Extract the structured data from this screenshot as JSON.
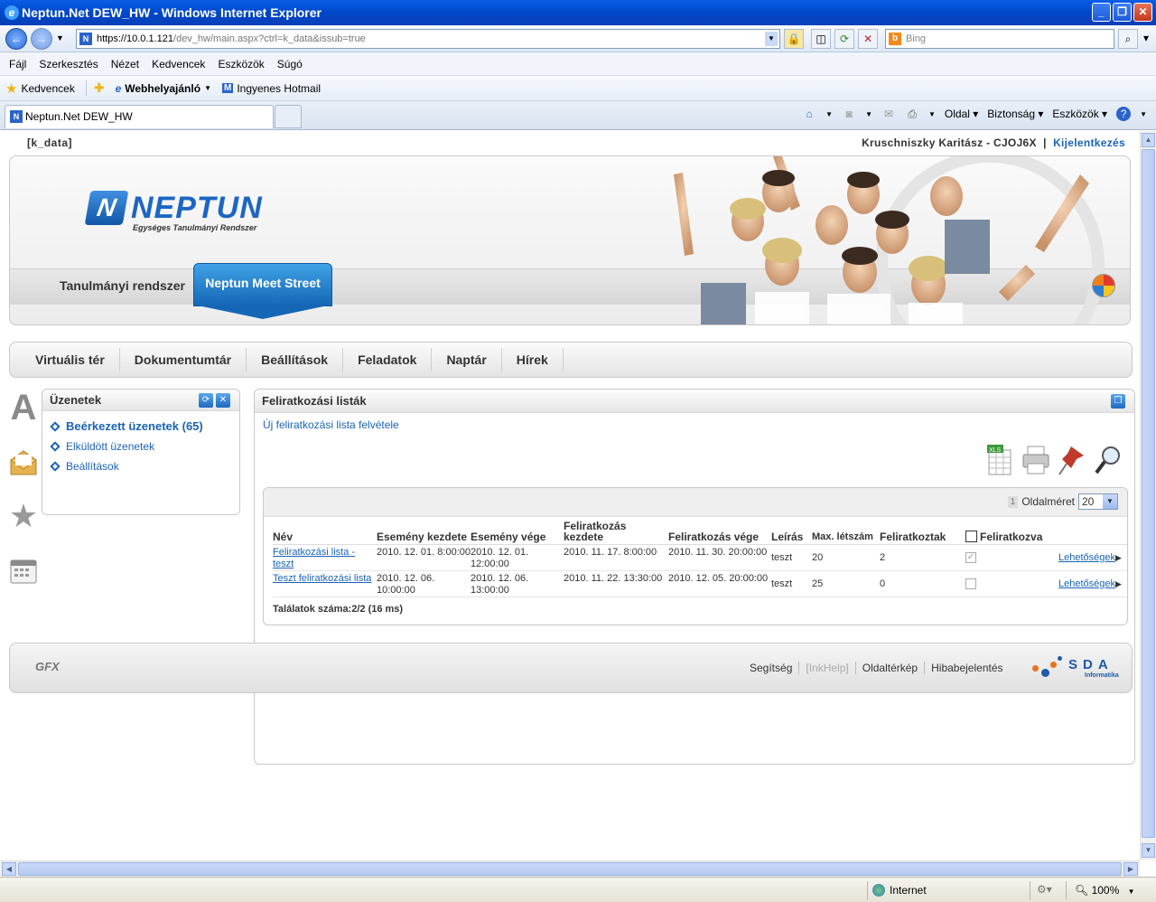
{
  "browser": {
    "window_title": "Neptun.Net DEW_HW - Windows Internet Explorer",
    "address_host": "https://10.0.1.121",
    "address_path": "/dev_hw/main.aspx?ctrl=k_data&issub=true",
    "search_placeholder": "Bing",
    "menu": [
      "Fájl",
      "Szerkesztés",
      "Nézet",
      "Kedvencek",
      "Eszközök",
      "Súgó"
    ],
    "favorites": {
      "label": "Kedvencek",
      "items": [
        "Webhelyajánló",
        "Ingyenes Hotmail"
      ]
    },
    "tab_title": "Neptun.Net DEW_HW",
    "command_bar": [
      "Oldal",
      "Biztonság",
      "Eszközök"
    ],
    "status": {
      "zone": "Internet",
      "zoom": "100%"
    }
  },
  "page": {
    "ctrl": "[k_data]",
    "user": "Kruschniszky Karitász - CJOJ6X",
    "separator": "|",
    "logout": "Kijelentkezés",
    "logo_text": "NEPTUN",
    "logo_sub": "Egységes Tanulmányi Rendszer",
    "header_tabs": [
      "Tanulmányi rendszer",
      "Neptun Meet Street"
    ],
    "nav": [
      "Virtuális tér",
      "Dokumentumtár",
      "Beállítások",
      "Feladatok",
      "Naptár",
      "Hírek"
    ]
  },
  "messages": {
    "title": "Üzenetek",
    "items": [
      "Beérkezett üzenetek (65)",
      "Elküldött üzenetek",
      "Beállítások"
    ]
  },
  "lists_panel": {
    "title": "Feliratkozási listák",
    "new_link": "Új feliratkozási lista felvétele",
    "page_number": "1",
    "page_size_label": "Oldalméret",
    "page_size": "20",
    "columns": [
      "Név",
      "Esemény kezdete",
      "Esemény vége",
      "Feliratkozás kezdete",
      "Feliratkozás vége",
      "Leírás",
      "Max. létszám",
      "Feliratkoztak",
      "Feliratkozva"
    ],
    "rows": [
      {
        "name": "Feliratkozási lista - teszt",
        "start": "2010. 12. 01. 8:00:00",
        "end": "2010. 12. 01. 12:00:00",
        "sub_start": "2010. 11. 17. 8:00:00",
        "sub_end": "2010. 11. 30. 20:00:00",
        "desc": "teszt",
        "max": "20",
        "count": "2",
        "checked": "✓",
        "options": "Lehetőségek"
      },
      {
        "name": "Teszt feliratkozási lista",
        "start": "2010. 12. 06. 10:00:00",
        "end": "2010. 12. 06. 13:00:00",
        "sub_start": "2010. 11. 22. 13:30:00",
        "sub_end": "2010. 12. 05. 20:00:00",
        "desc": "teszt",
        "max": "25",
        "count": "0",
        "checked": "",
        "options": "Lehetőségek"
      }
    ],
    "found": "Találatok száma:2/2 (16 ms)"
  },
  "footer": {
    "links": [
      "Segítség",
      "[InkHelp]",
      "Oldaltérkép",
      "Hibabejelentés"
    ],
    "gfx": "GFX",
    "sda": "SDA",
    "sda_sub": "Informatika"
  },
  "colors": {
    "accent": "#1a63b8",
    "ie_title": "#0047c9"
  }
}
